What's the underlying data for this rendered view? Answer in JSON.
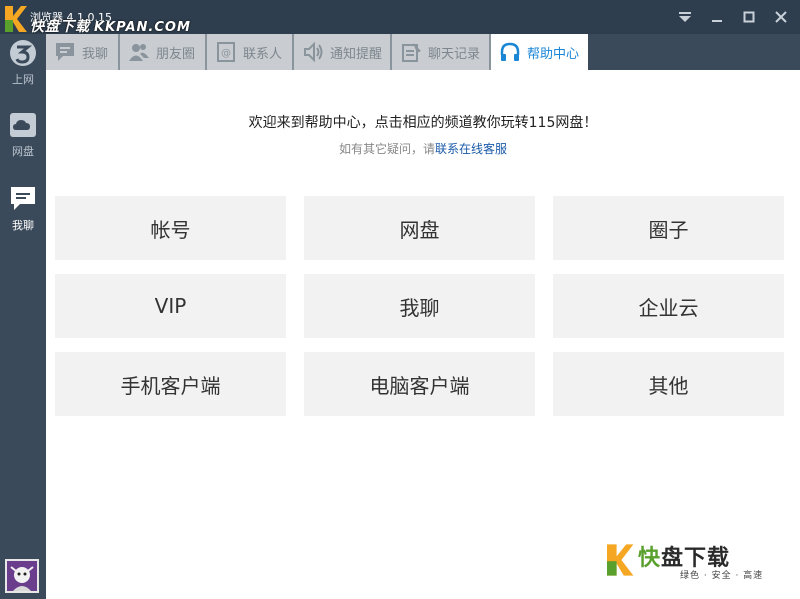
{
  "window": {
    "title": "浏览器 4.1.0.15",
    "watermark": "快盘下载",
    "watermark_url": "KKPAN.COM"
  },
  "sidebar": {
    "items": [
      {
        "label": "上网",
        "icon": "browser-icon"
      },
      {
        "label": "网盘",
        "icon": "cloud-icon"
      },
      {
        "label": "我聊",
        "icon": "chat-icon",
        "active": true
      }
    ]
  },
  "tabs": [
    {
      "label": "我聊",
      "icon": "chat-bubble-icon"
    },
    {
      "label": "朋友圈",
      "icon": "friends-icon"
    },
    {
      "label": "联系人",
      "icon": "contacts-icon"
    },
    {
      "label": "通知提醒",
      "icon": "speaker-icon"
    },
    {
      "label": "聊天记录",
      "icon": "history-icon"
    },
    {
      "label": "帮助中心",
      "icon": "headphones-icon",
      "active": true
    }
  ],
  "help": {
    "welcome": "欢迎来到帮助中心，点击相应的频道教你玩转115网盘！",
    "sub_prefix": "如有其它疑问，请",
    "sub_link": "联系在线客服",
    "channels": [
      "帐号",
      "网盘",
      "圈子",
      "VIP",
      "我聊",
      "企业云",
      "手机客户端",
      "电脑客户端",
      "其他"
    ]
  },
  "bottom_watermark": {
    "brand_a": "快",
    "brand_b": "盘下载",
    "tagline": "绿色 · 安全 · 高速"
  },
  "colors": {
    "sidebar_bg": "#3b4a5a",
    "tab_inactive": "#c9cdd1",
    "tab_active_text": "#1a86d6",
    "link": "#1a5aa8"
  }
}
